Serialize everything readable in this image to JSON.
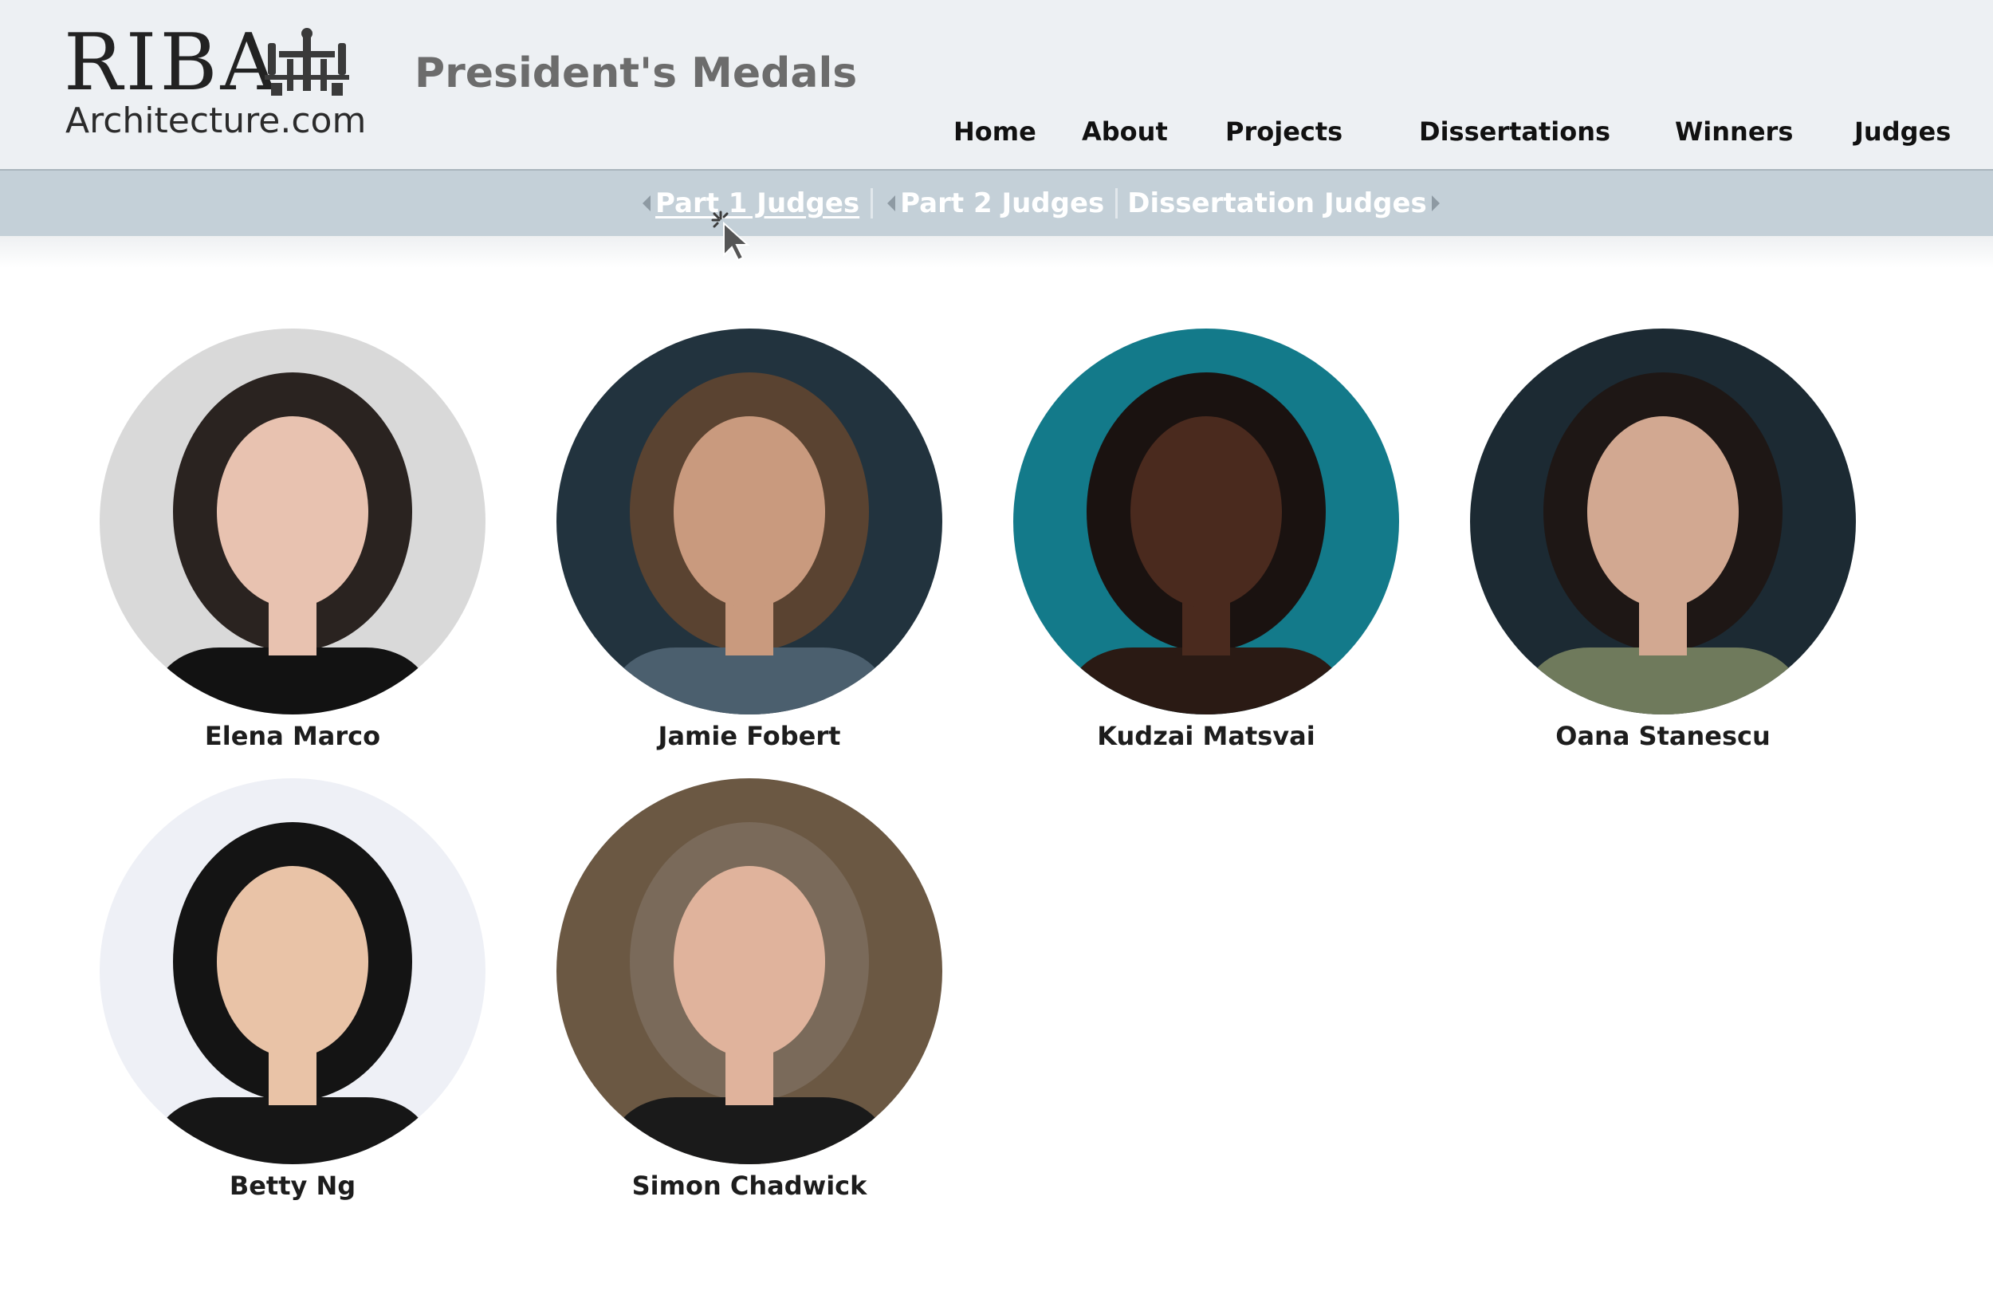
{
  "header": {
    "logo_main": "RIBA",
    "logo_sub": "Architecture.com",
    "site_title": "President's Medals"
  },
  "nav": {
    "items": [
      {
        "label": "Home"
      },
      {
        "label": "About"
      },
      {
        "label": "Projects"
      },
      {
        "label": "Dissertations"
      },
      {
        "label": "Winners"
      },
      {
        "label": "Judges"
      }
    ]
  },
  "subnav": {
    "items": [
      {
        "label": "Part 1 Judges",
        "active": true
      },
      {
        "label": "Part 2 Judges",
        "active": false
      },
      {
        "label": "Dissertation Judges",
        "active": false
      }
    ]
  },
  "judges": [
    {
      "name": "Elena Marco",
      "bg": "#d9d9d9",
      "skin": "#e8c2b0",
      "hair": "#2a2320",
      "shirt": "#121212"
    },
    {
      "name": "Jamie Fobert",
      "bg": "#22333e",
      "skin": "#c99a7e",
      "hair": "#5a4331",
      "shirt": "#4b5f6e"
    },
    {
      "name": "Kudzai Matsvai",
      "bg": "#137a8a",
      "skin": "#4a2a1e",
      "hair": "#1a1210",
      "shirt": "#2a1a14"
    },
    {
      "name": "Oana Stanescu",
      "bg": "#1c2a33",
      "skin": "#d2a891",
      "hair": "#1e1715",
      "shirt": "#6f7a5c"
    },
    {
      "name": "Betty Ng",
      "bg": "#eef0f6",
      "skin": "#e9c3a7",
      "hair": "#141414",
      "shirt": "#161616"
    },
    {
      "name": "Simon Chadwick",
      "bg": "#6b5843",
      "skin": "#e0b39c",
      "hair": "#7a6a5a",
      "shirt": "#1a1a1a"
    }
  ],
  "colors": {
    "header_bg": "#edf0f3",
    "subnav_bg": "#c4d0d8",
    "subnav_text": "#ffffff",
    "title_text": "#6c6c6c"
  }
}
